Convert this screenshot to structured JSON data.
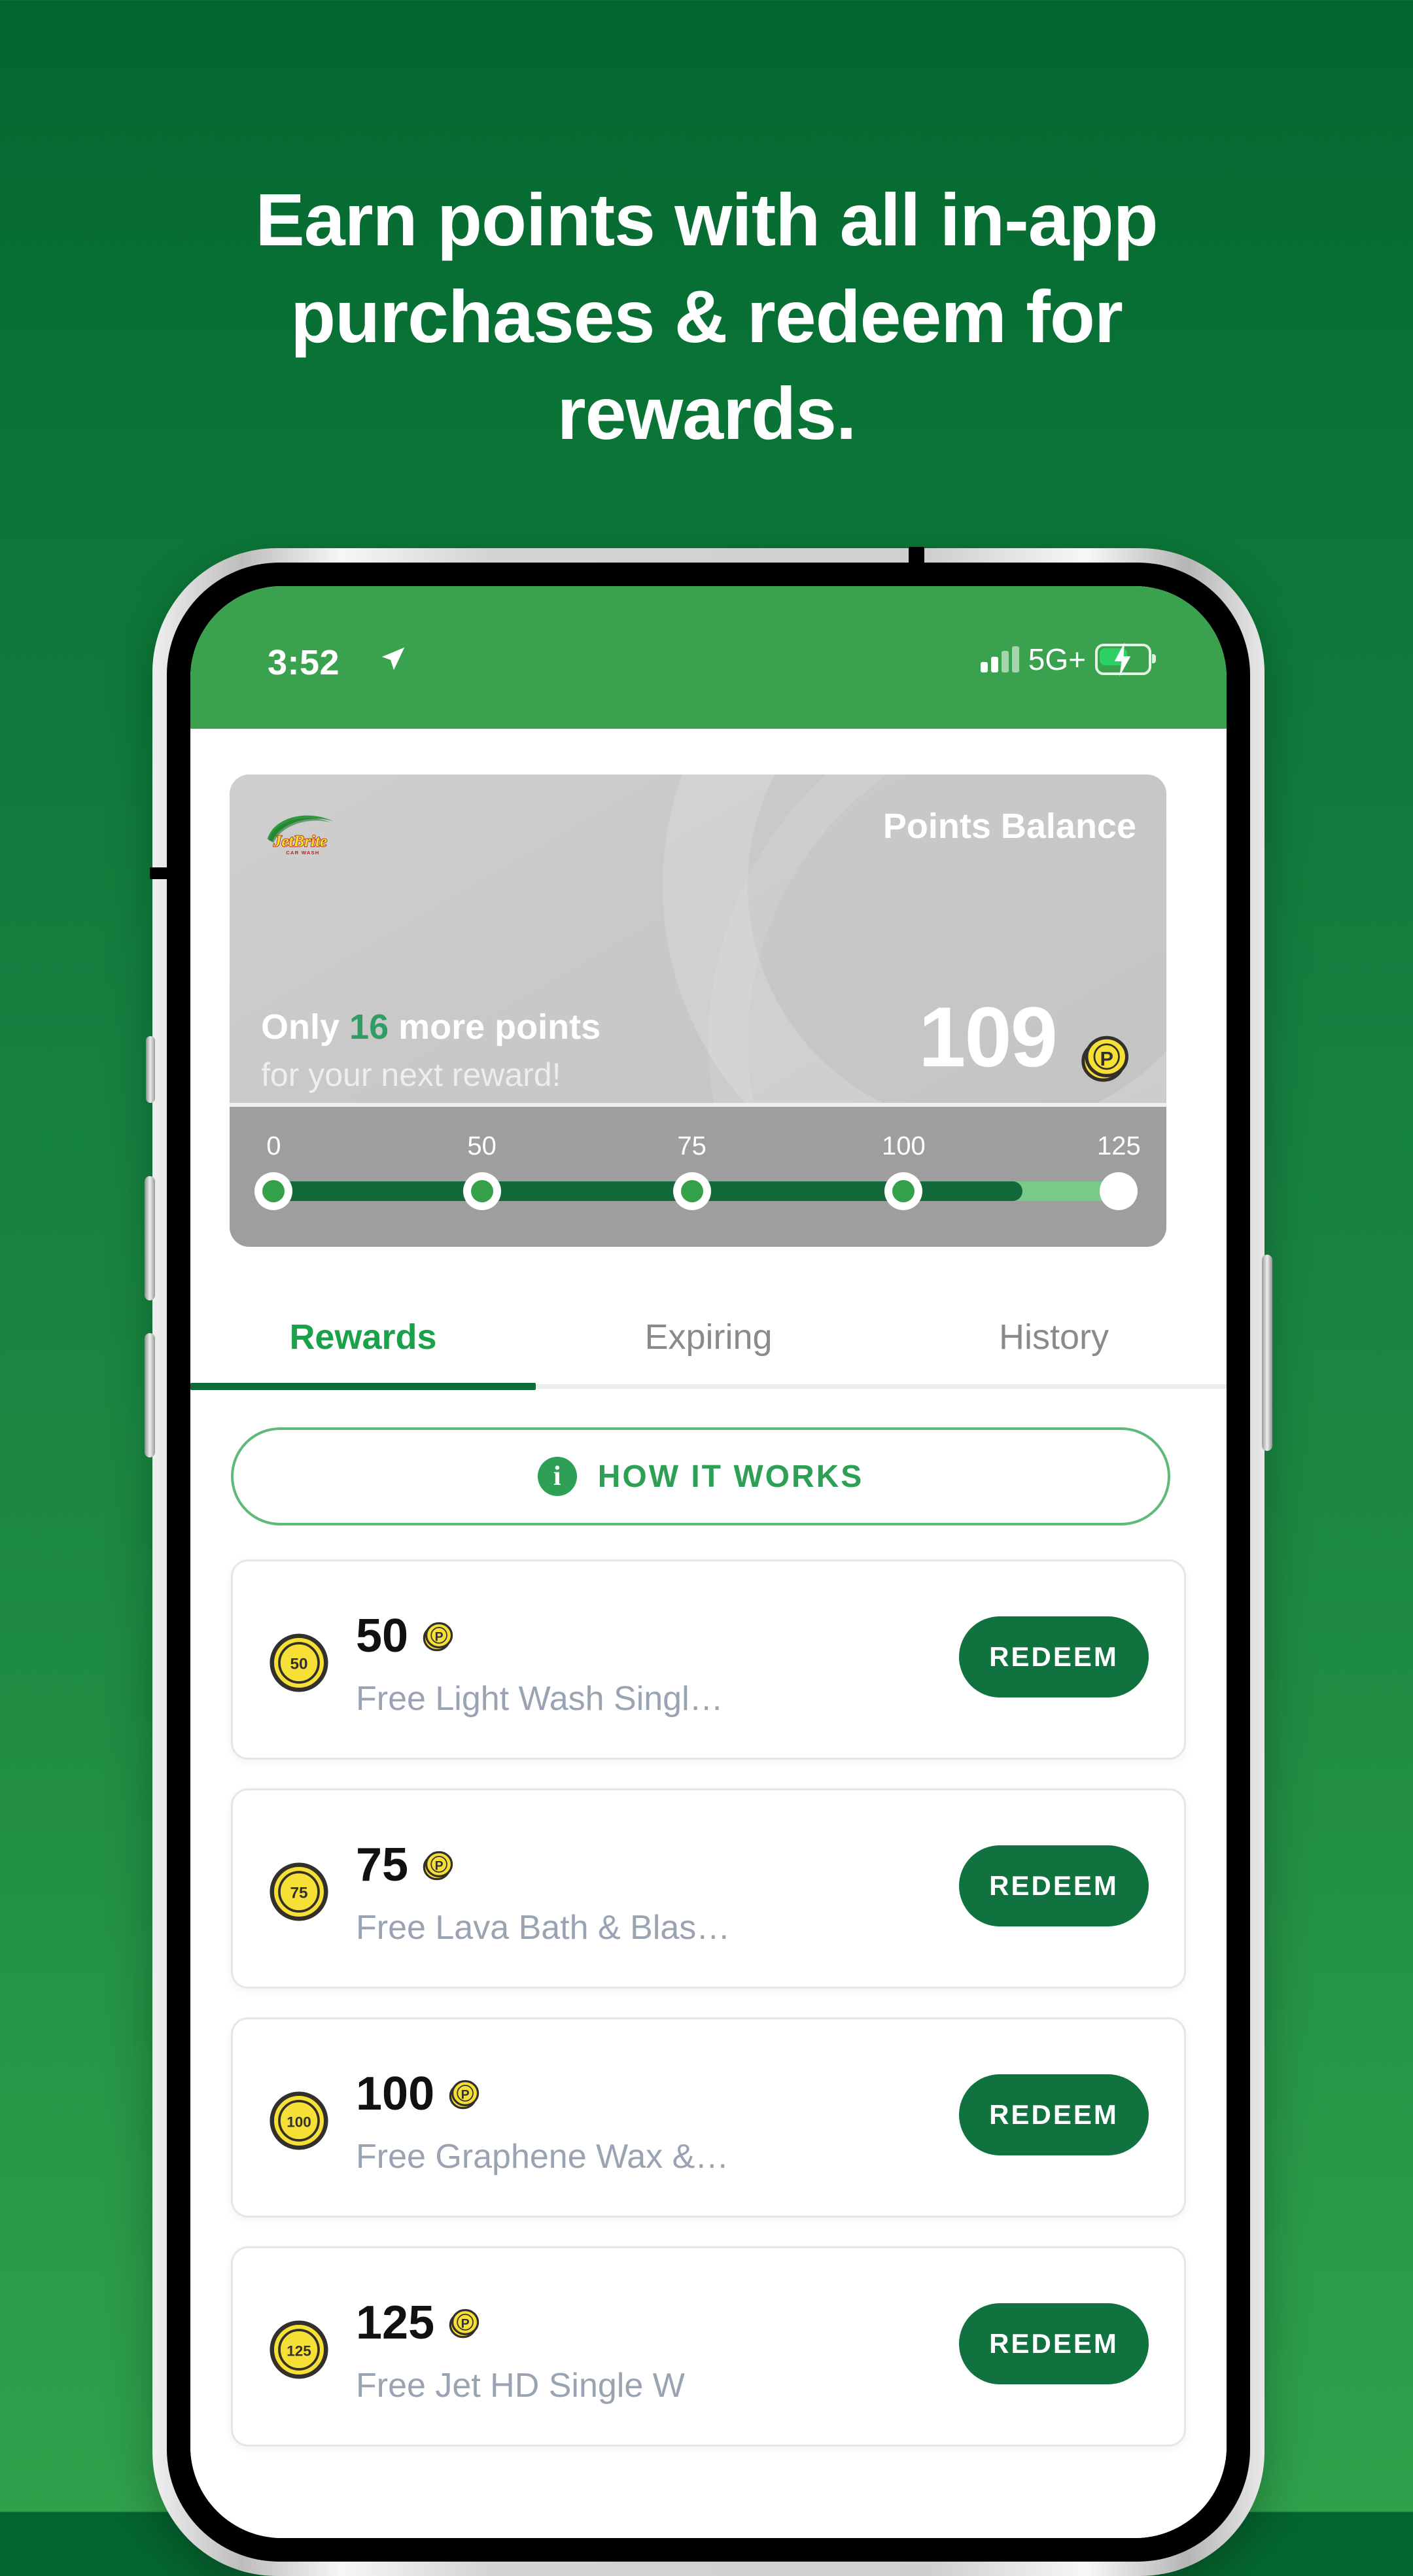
{
  "headline": "Earn points with all in-app purchases & redeem for rewards.",
  "status_bar": {
    "time": "3:52",
    "location_icon": "location-arrow-icon",
    "network": "5G+",
    "signal_icon": "signal-bars-icon",
    "battery_icon": "battery-charging-icon"
  },
  "points_card": {
    "brand_logo": "jetbrite-car-wash-logo",
    "brand_name": "JetBrite",
    "brand_tagline": "CAR WASH",
    "title": "Points Balance",
    "only_prefix": "Only ",
    "only_value": "16",
    "only_suffix": " more points",
    "subtitle": "for your next reward!",
    "balance": "109",
    "coin_icon": "points-coin-icon",
    "accent_green": "#2f9e63"
  },
  "progress": {
    "milestones": [
      "0",
      "50",
      "75",
      "100",
      "125"
    ],
    "current": 109,
    "max": 125,
    "track_color": "#79c987",
    "fill_color": "#14693b"
  },
  "tabs": [
    {
      "label": "Rewards",
      "active": true
    },
    {
      "label": "Expiring",
      "active": false
    },
    {
      "label": "History",
      "active": false
    }
  ],
  "how_it_works": {
    "icon": "info-icon",
    "icon_glyph": "i",
    "label": "HOW IT WORKS"
  },
  "rewards": [
    {
      "badge": "50",
      "points": "50",
      "coin_icon": "points-coin-icon",
      "description": "Free Light Wash Singl…",
      "button": "REDEEM"
    },
    {
      "badge": "75",
      "points": "75",
      "coin_icon": "points-coin-icon",
      "description": "Free Lava Bath & Blas…",
      "button": "REDEEM"
    },
    {
      "badge": "100",
      "points": "100",
      "coin_icon": "points-coin-icon",
      "description": "Free Graphene Wax &…",
      "button": "REDEEM"
    },
    {
      "badge": "125",
      "points": "125",
      "coin_icon": "points-coin-icon",
      "description": "Free Jet HD Single W",
      "button": "REDEEM"
    }
  ],
  "colors": {
    "bg_top": "#04652f",
    "bg_bottom": "#2fa14b",
    "status_bar": "#3aa14e",
    "tab_active": "#19a24a",
    "redeem": "#10723e",
    "coin_yellow": "#f7e035"
  }
}
